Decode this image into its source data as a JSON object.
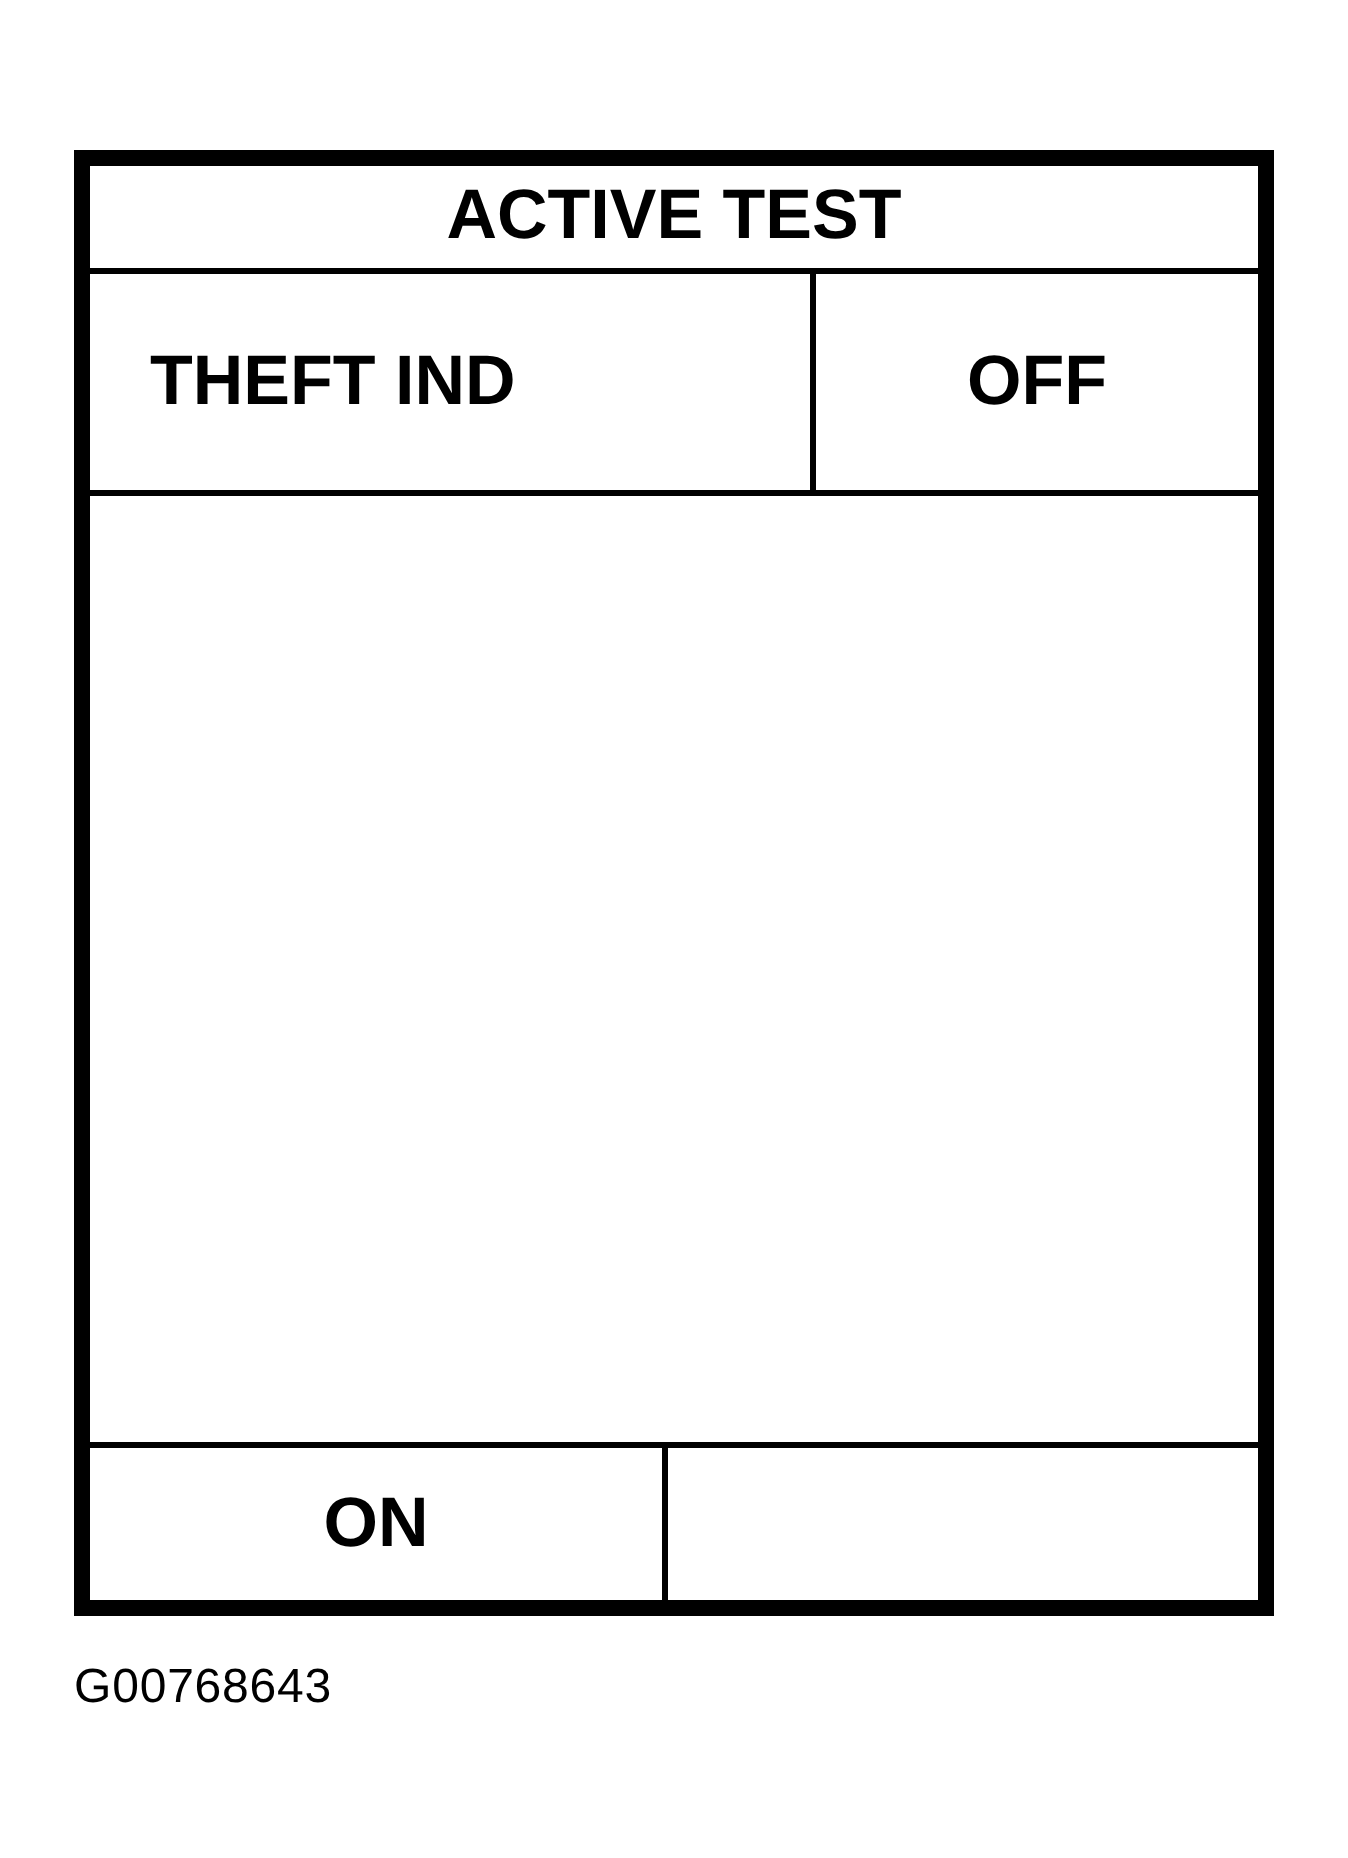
{
  "screen": {
    "title": "ACTIVE TEST",
    "item_row": {
      "label": "THEFT IND",
      "value": "OFF"
    },
    "softkeys": [
      {
        "kind": "labeled",
        "label": "ON"
      },
      {
        "kind": "blank"
      }
    ]
  },
  "figure_code": "G00768643"
}
